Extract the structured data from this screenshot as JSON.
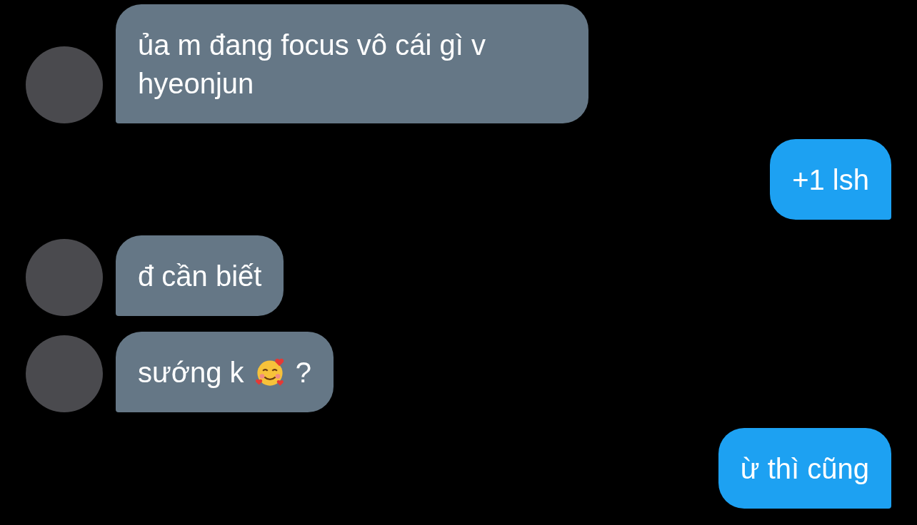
{
  "messages": [
    {
      "kind": "received",
      "parts": [
        {
          "kind": "text",
          "text": "ủa m đang focus vô cái gì v hyeonjun"
        }
      ]
    },
    {
      "kind": "sent",
      "parts": [
        {
          "kind": "text",
          "text": "+1 lsh"
        }
      ]
    },
    {
      "kind": "received",
      "parts": [
        {
          "kind": "text",
          "text": "đ cần biết"
        }
      ]
    },
    {
      "kind": "received",
      "parts": [
        {
          "kind": "text",
          "text": "sướng k"
        },
        {
          "kind": "emoji"
        },
        {
          "kind": "text",
          "text": "?"
        }
      ]
    },
    {
      "kind": "sent",
      "parts": [
        {
          "kind": "text",
          "text": "ừ thì cũng"
        }
      ]
    }
  ]
}
